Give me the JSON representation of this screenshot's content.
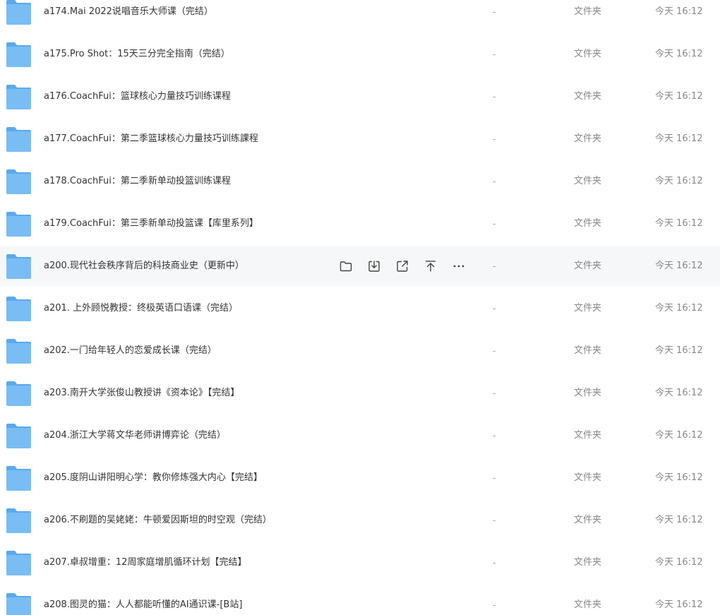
{
  "columns": {
    "size_placeholder": "-",
    "type_label": "文件夹",
    "time_label": "今天 16:12"
  },
  "hovered_index": 6,
  "row_actions": [
    "folder-icon",
    "download-icon",
    "share-icon",
    "pin-to-top-icon",
    "more-icon"
  ],
  "colors": {
    "folder_main": "#6fb7f2",
    "folder_dark": "#4fa0e6",
    "hover_bg": "#f6f7f9"
  },
  "files": [
    {
      "name": "a174.Mai  2022说唱音乐大师课（完结）"
    },
    {
      "name": "a175.Pro Shot：15天三分完全指南（完结）"
    },
    {
      "name": "a176.CoachFui：篮球核心力量技巧训练课程"
    },
    {
      "name": "a177.CoachFui：第二季篮球核心力量技巧训练課程"
    },
    {
      "name": "a178.CoachFui：第二季新单动投篮训练课程"
    },
    {
      "name": "a179.CoachFui：第三季新单动投篮课【库里系列】"
    },
    {
      "name": "a200.现代社会秩序背后的科技商业史（更新中）"
    },
    {
      "name": "a201. 上外顾悦教授：终极英语口语课（完结）"
    },
    {
      "name": "a202.一门给年轻人的恋爱成长课（完结）"
    },
    {
      "name": "a203.南开大学张俊山教授讲《资本论》【完结】"
    },
    {
      "name": "a204.浙江大学蒋文华老师讲博弈论（完结）"
    },
    {
      "name": "a205.度阴山讲阳明心学：教你修炼强大内心【完结】"
    },
    {
      "name": "a206.不刷题的吴姥姥：牛顿爱因斯坦的时空观（完结）"
    },
    {
      "name": "a207.卓叔增重：12周家庭增肌循环计划【完结】"
    },
    {
      "name": "a208.图灵的猫：人人都能听懂的AI通识课-[B站]"
    }
  ]
}
